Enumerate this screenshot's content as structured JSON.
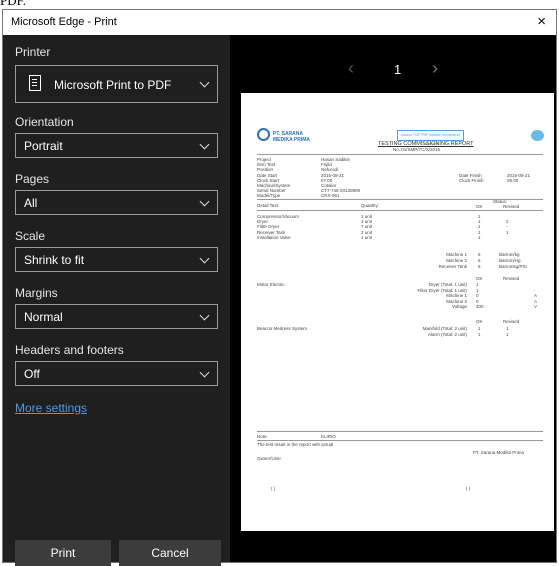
{
  "above_text": "PDF.",
  "window": {
    "title": "Microsoft Edge - Print",
    "close_glyph": "×"
  },
  "settings": {
    "printer": {
      "label": "Printer",
      "value": "Microsoft Print to PDF"
    },
    "orientation": {
      "label": "Orientation",
      "value": "Portrait"
    },
    "pages": {
      "label": "Pages",
      "value": "All"
    },
    "scale": {
      "label": "Scale",
      "value": "Shrink to fit"
    },
    "margins": {
      "label": "Margins",
      "value": "Normal"
    },
    "headers": {
      "label": "Headers and footers",
      "value": "Off"
    },
    "more_settings": "More settings"
  },
  "buttons": {
    "print": "Print",
    "cancel": "Cancel"
  },
  "pager": {
    "prev": "‹",
    "page": "1",
    "next": "›"
  },
  "document": {
    "company": "PT. SARANA MEDIKA PRIMA",
    "stamp_text": "Sarana TMP PNP website ecommerce Indonesia",
    "title": "TESTING COMMISSIONING REPORT",
    "report_no": "No. 01/SMP/TC/X/2015",
    "info_rows": [
      {
        "k": "Project",
        "v": "Hasan Sadikin"
      },
      {
        "k": "Item Test",
        "v": "Frijild"
      },
      {
        "k": "Position",
        "v": "Nefurodi"
      },
      {
        "k": "Date Start",
        "v": "2015-09-21",
        "k2": "Date Finish",
        "v2": "2015-09-21"
      },
      {
        "k": "Clock Start",
        "v": "07.00",
        "k2": "Clock Finish",
        "v2": "08.00"
      },
      {
        "k": "Machine/System",
        "v": "Cotalior"
      },
      {
        "k": "Serial Number",
        "v": "CT7-748-20130909"
      },
      {
        "k": "Model/Type",
        "v": "CRX-061"
      }
    ],
    "detail_header": {
      "test": "Detail Test:",
      "qty": "Quantity:",
      "status": "Status:",
      "ok": "OK",
      "revised": "Revised"
    },
    "items": [
      {
        "name": "Compressor/Vacuum",
        "qty": "1 unit",
        "ok": "1",
        "rev": ""
      },
      {
        "name": "Dryer",
        "qty": "3 unit",
        "ok": "1",
        "rev": "2"
      },
      {
        "name": "Filter Dryer",
        "qty": "7 unit",
        "ok": "1",
        "rev": "-"
      },
      {
        "name": "Receiver Tank",
        "qty": "2 unit",
        "ok": "1",
        "rev": "1"
      },
      {
        "name": "Installation Valve",
        "qty": "1 unit",
        "ok": "1",
        "rev": ""
      }
    ],
    "pressure_rows": [
      {
        "k": "Machine 1",
        "ok": "6",
        "rev": "Barmm/kg"
      },
      {
        "k": "Machine 2",
        "ok": "6",
        "rev": "Barmm/Hg"
      },
      {
        "k": "Receiver Tank",
        "ok": "6",
        "rev": "Barmmkg/PSI"
      }
    ],
    "motor_title": "Motor Electric",
    "motor_rows": [
      {
        "k": "Dryer (Total: 1 unit)",
        "ok": "1",
        "rev": ""
      },
      {
        "k": "Filter Dryer (Total: 1 unit)",
        "ok": "1",
        "rev": "-"
      },
      {
        "k": "Machine 1",
        "ok": "0",
        "rev": "A"
      },
      {
        "k": "Machine 2",
        "ok": "0",
        "rev": "A"
      },
      {
        "k": "Voltage",
        "ok": "400",
        "rev": "V"
      }
    ],
    "beacon_title": "Beacon Medress System",
    "beacon_rows": [
      {
        "k": "Manifold (Total: 2 unit)",
        "ok": "1",
        "rev": "1"
      },
      {
        "k": "Alarm (Total: 2 unit)",
        "ok": "1",
        "rev": "1"
      }
    ],
    "note_label": "Note:",
    "note_value": "KLIRIO",
    "note_line": "The test result in the report with actual",
    "company_sign": "PT. Sarana Medika Prima",
    "owner_label": "Owner/User",
    "sig_left": "(                    )",
    "sig_right": "(                    )"
  }
}
